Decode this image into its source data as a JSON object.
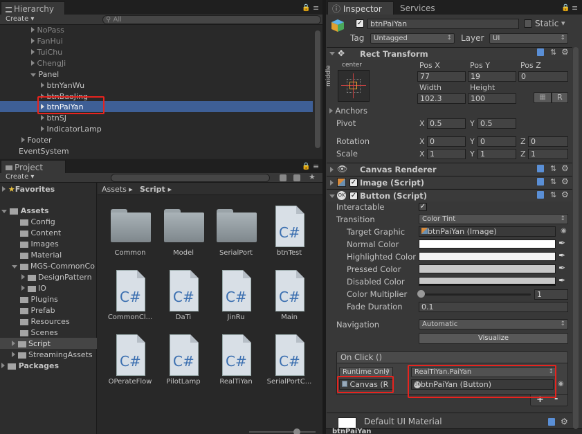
{
  "hierarchy": {
    "tab_label": "Hierarchy",
    "create_label": "Create",
    "search_placeholder": "All",
    "items": [
      {
        "label": "NoPass",
        "dim": true
      },
      {
        "label": "FanHui",
        "dim": true
      },
      {
        "label": "TuiChu",
        "dim": true
      },
      {
        "label": "ChengJi",
        "dim": true
      },
      {
        "label": "Panel",
        "dim": false
      },
      {
        "label": "btnYanWu",
        "dim": false
      },
      {
        "label": "btnBaoJing",
        "dim": false
      },
      {
        "label": "btnPaiYan",
        "dim": false
      },
      {
        "label": "btnSJ",
        "dim": false
      },
      {
        "label": "IndicatorLamp",
        "dim": false
      },
      {
        "label": "Footer",
        "dim": false
      },
      {
        "label": "EventSystem",
        "dim": false
      }
    ]
  },
  "project": {
    "tab_label": "Project",
    "create_label": "Create",
    "breadcrumb": {
      "root": "Assets",
      "current": "Script"
    },
    "tree": [
      {
        "label": "Favorites",
        "bold": true
      },
      {
        "label": "Assets",
        "bold": true
      },
      {
        "label": "Config"
      },
      {
        "label": "Content"
      },
      {
        "label": "Images"
      },
      {
        "label": "Material"
      },
      {
        "label": "MGS-CommonCo"
      },
      {
        "label": "DesignPattern"
      },
      {
        "label": "IO"
      },
      {
        "label": "Plugins"
      },
      {
        "label": "Prefab"
      },
      {
        "label": "Resources"
      },
      {
        "label": "Scenes"
      },
      {
        "label": "Script"
      },
      {
        "label": "StreamingAssets"
      },
      {
        "label": "Packages",
        "bold": true
      }
    ],
    "assets": [
      {
        "label": "Common",
        "kind": "folder"
      },
      {
        "label": "Model",
        "kind": "folder"
      },
      {
        "label": "SerialPort",
        "kind": "folder"
      },
      {
        "label": "btnTest",
        "kind": "script"
      },
      {
        "label": "CommonCl...",
        "kind": "script"
      },
      {
        "label": "DaTi",
        "kind": "script"
      },
      {
        "label": "JinRu",
        "kind": "script"
      },
      {
        "label": "Main",
        "kind": "script"
      },
      {
        "label": "OPerateFlow",
        "kind": "script"
      },
      {
        "label": "PilotLamp",
        "kind": "script"
      },
      {
        "label": "RealTiYan",
        "kind": "script"
      },
      {
        "label": "SerialPortC...",
        "kind": "script"
      }
    ],
    "script_glyph": "C#"
  },
  "inspector": {
    "tab_label": "Inspector",
    "services_label": "Services",
    "object_name": "btnPaiYan",
    "static_label": "Static",
    "tag_label": "Tag",
    "tag_value": "Untagged",
    "layer_label": "Layer",
    "layer_value": "UI",
    "rect_transform": {
      "title": "Rect Transform",
      "anchor_h": "center",
      "anchor_v": "middle",
      "pos_x_label": "Pos X",
      "pos_x": "77",
      "pos_y_label": "Pos Y",
      "pos_y": "19",
      "pos_z_label": "Pos Z",
      "pos_z": "0",
      "width_label": "Width",
      "width": "102.3",
      "height_label": "Height",
      "height": "100",
      "r_label": "R",
      "anchors_label": "Anchors",
      "pivot_label": "Pivot",
      "pivot_x": "0.5",
      "pivot_y": "0.5",
      "rotation_label": "Rotation",
      "rot_x": "0",
      "rot_y": "0",
      "rot_z": "0",
      "scale_label": "Scale",
      "scale_x": "1",
      "scale_y": "1",
      "scale_z": "1",
      "x": "X",
      "y": "Y",
      "z": "Z"
    },
    "canvas_renderer": {
      "title": "Canvas Renderer"
    },
    "image_script": {
      "title": "Image (Script)"
    },
    "button_script": {
      "title": "Button (Script)",
      "interactable_label": "Interactable",
      "transition_label": "Transition",
      "transition_value": "Color Tint",
      "target_graphic_label": "Target Graphic",
      "target_graphic_value": "btnPaiYan (Image)",
      "normal_color_label": "Normal Color",
      "highlighted_color_label": "Highlighted Color",
      "pressed_color_label": "Pressed Color",
      "disabled_color_label": "Disabled Color",
      "color_multiplier_label": "Color Multiplier",
      "color_multiplier_value": "1",
      "fade_duration_label": "Fade Duration",
      "fade_duration_value": "0.1",
      "navigation_label": "Navigation",
      "navigation_value": "Automatic",
      "visualize_label": "Visualize",
      "onclick_label": "On Click ()",
      "runtime_label": "Runtime Only",
      "function_value": "RealTiYan.PaiYan",
      "object_value": "Canvas (R",
      "argument_value": "btnPaiYan (Button)",
      "plus": "+",
      "minus": "-"
    },
    "material": {
      "title": "Default UI Material"
    },
    "footer_name": "btnPaiYan"
  },
  "colors": {
    "selection": "#3e5f96",
    "annotation_red": "#e8231e"
  }
}
